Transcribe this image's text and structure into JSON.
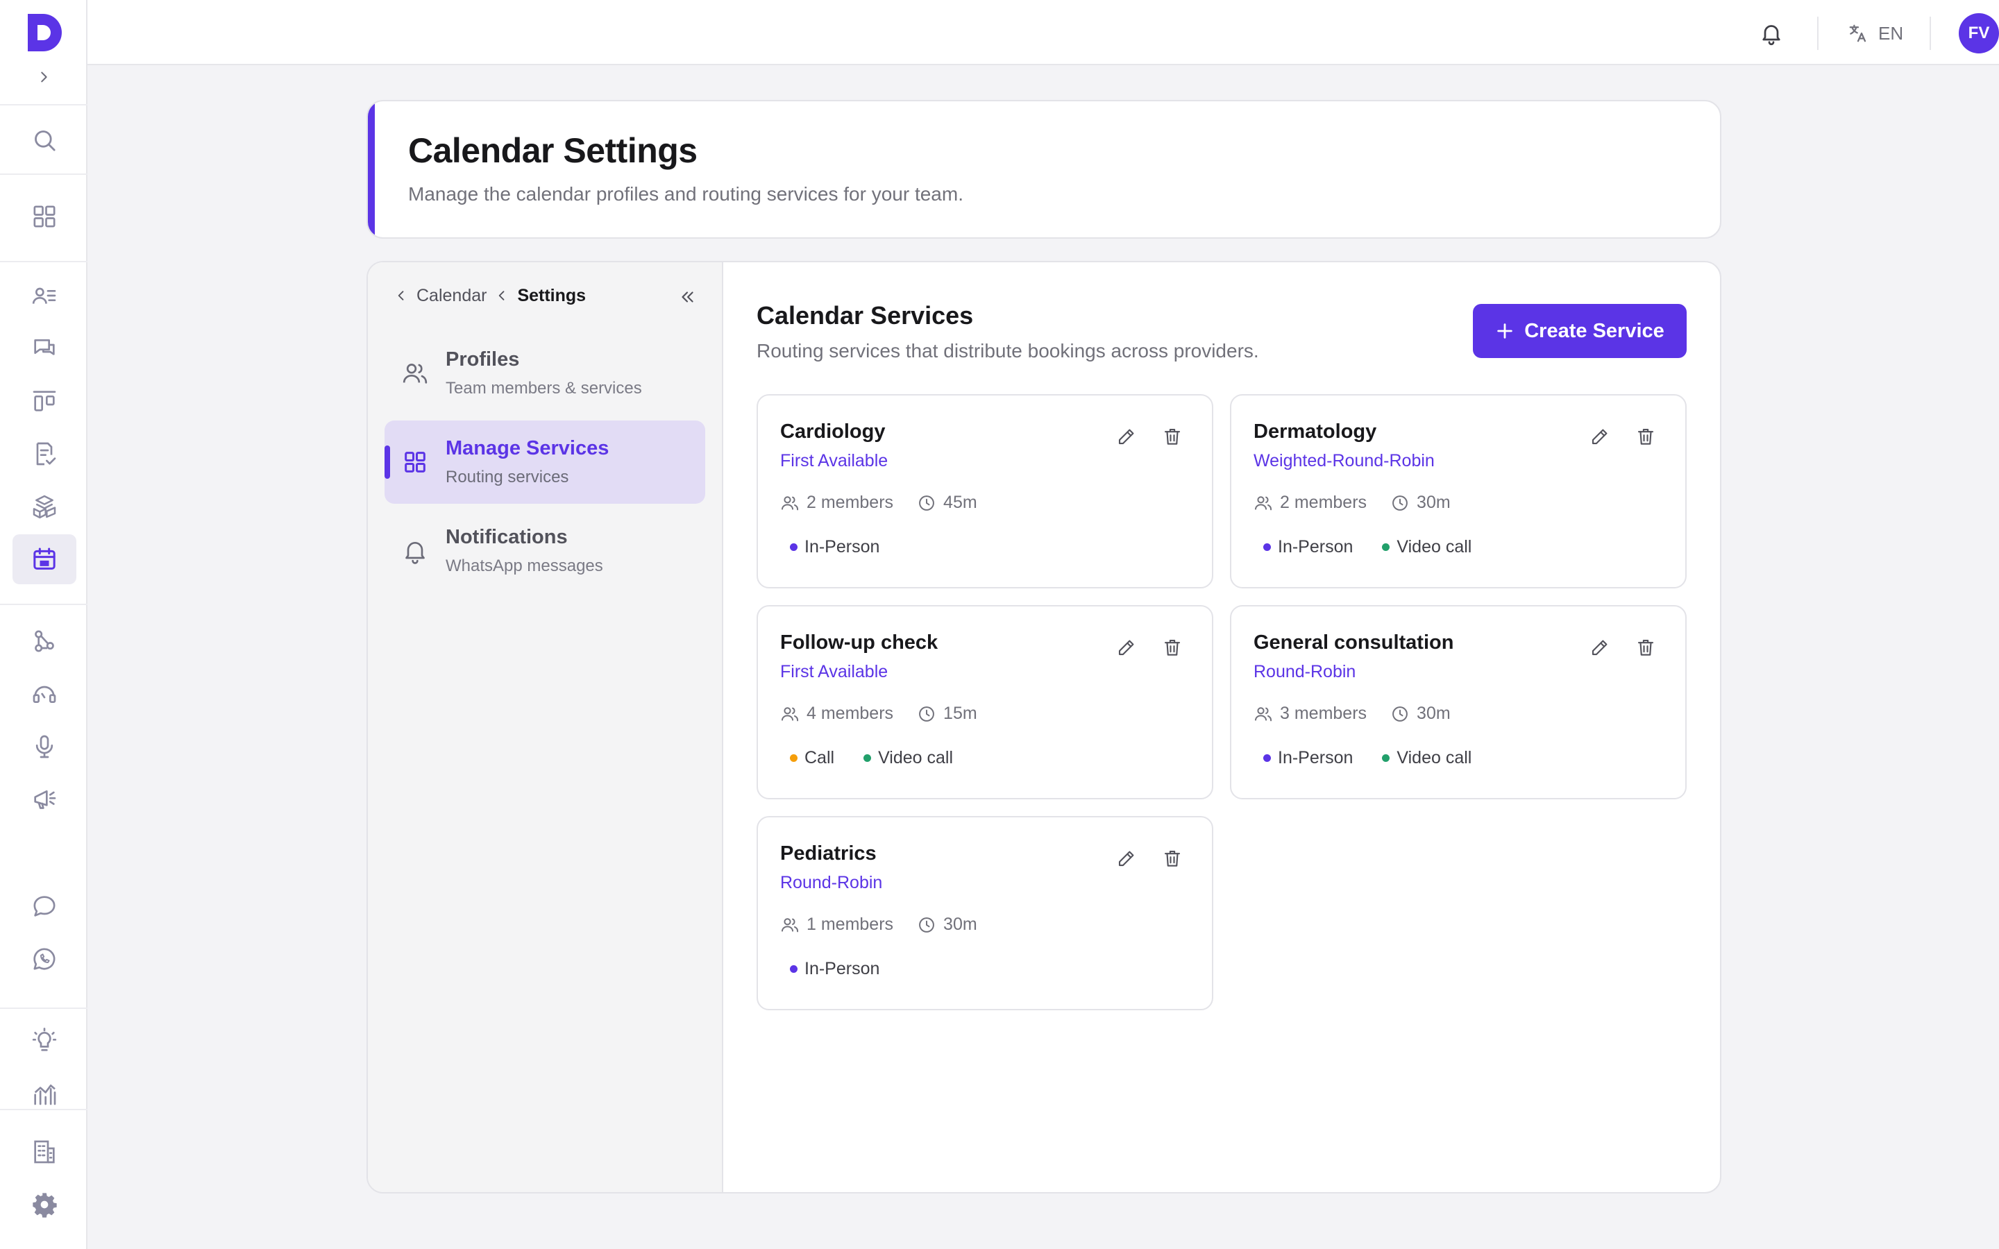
{
  "topbar": {
    "language": "EN",
    "user_initials": "FV"
  },
  "header": {
    "title": "Calendar Settings",
    "subtitle": "Manage the calendar profiles and routing services for your team."
  },
  "breadcrumb": {
    "parent": "Calendar",
    "current": "Settings"
  },
  "side_nav": [
    {
      "title": "Profiles",
      "subtitle": "Team members & services",
      "icon": "users-icon",
      "active": false
    },
    {
      "title": "Manage Services",
      "subtitle": "Routing services",
      "icon": "grid-icon",
      "active": true
    },
    {
      "title": "Notifications",
      "subtitle": "WhatsApp messages",
      "icon": "bell-icon",
      "active": false
    }
  ],
  "content": {
    "title": "Calendar Services",
    "subtitle": "Routing services that distribute bookings across providers.",
    "create_label": "Create Service"
  },
  "services": [
    {
      "name": "Cardiology",
      "strategy": "First Available",
      "members": "2 members",
      "duration": "45m",
      "tags": [
        {
          "label": "In-Person",
          "color": "#5b34e6"
        }
      ]
    },
    {
      "name": "Dermatology",
      "strategy": "Weighted-Round-Robin",
      "members": "2 members",
      "duration": "30m",
      "tags": [
        {
          "label": "In-Person",
          "color": "#5b34e6"
        },
        {
          "label": "Video call",
          "color": "#22a06b"
        }
      ]
    },
    {
      "name": "Follow-up check",
      "strategy": "First Available",
      "members": "4 members",
      "duration": "15m",
      "tags": [
        {
          "label": "Call",
          "color": "#f59e0b"
        },
        {
          "label": "Video call",
          "color": "#22a06b"
        }
      ]
    },
    {
      "name": "General consultation",
      "strategy": "Round-Robin",
      "members": "3 members",
      "duration": "30m",
      "tags": [
        {
          "label": "In-Person",
          "color": "#5b34e6"
        },
        {
          "label": "Video call",
          "color": "#22a06b"
        }
      ]
    },
    {
      "name": "Pediatrics",
      "strategy": "Round-Robin",
      "members": "1 members",
      "duration": "30m",
      "tags": [
        {
          "label": "In-Person",
          "color": "#5b34e6"
        }
      ]
    }
  ],
  "rail_icons": [
    "search-icon",
    "dashboard-icon",
    "contacts-icon",
    "conversations-icon",
    "pipeline-icon",
    "tasks-icon",
    "products-icon",
    "calendar-icon",
    "automation-icon",
    "support-icon",
    "voice-icon",
    "campaigns-icon",
    "chat-icon",
    "whatsapp-icon",
    "ideas-icon",
    "analytics-icon",
    "company-icon",
    "settings-icon"
  ],
  "colors": {
    "accent": "#5b34e6",
    "video": "#22a06b",
    "call": "#f59e0b"
  }
}
